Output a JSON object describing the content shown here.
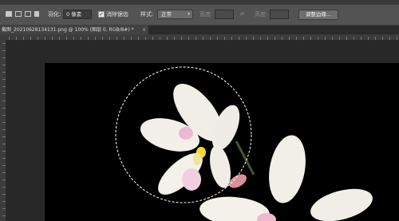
{
  "options": {
    "feather_label": "羽化:",
    "feather_value": "0 像素",
    "antialias_checked": true,
    "antialias_label": "消除锯齿",
    "style_label": "样式:",
    "style_value": "正常",
    "width_label": "宽度:",
    "height_label": "高度:",
    "refine_edge_button": "调整边缘..."
  },
  "document_tab": {
    "title": "截图_20210628134131.png @ 100% (图层 0, RGB/8#) *",
    "close_glyph": "×"
  },
  "colors": {
    "options_bar": "#535353",
    "canvas": "#000000",
    "workspace": "#282828",
    "petal": "#f2efe9",
    "selection_marquee": "#ffffff"
  }
}
